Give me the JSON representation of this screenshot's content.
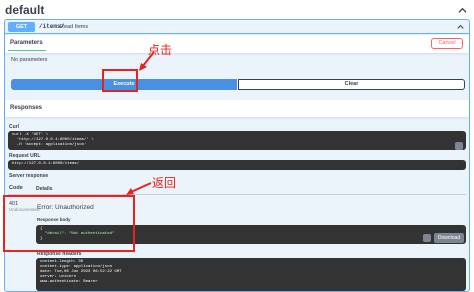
{
  "section": {
    "title": "default"
  },
  "operation": {
    "method": "GET",
    "path": "/items/",
    "description": "Read Items"
  },
  "tabs": {
    "parameters_label": "Parameters",
    "cancel_label": "Cancel"
  },
  "params": {
    "empty_text": "No parameters"
  },
  "actions": {
    "execute_label": "Execute",
    "clear_label": "Clear"
  },
  "responses": {
    "title": "Responses",
    "curl_label": "Curl",
    "curl_lines": [
      "curl -X 'GET' \\",
      "  'http://127.0.0.1:8000/items/' \\",
      "  -H 'accept: application/json'"
    ],
    "request_url_label": "Request URL",
    "request_url": "http://127.0.0.1:8000/items/",
    "server_response_label": "Server response",
    "col_code": "Code",
    "col_details": "Details",
    "status_code": "401",
    "undocumented": "Undocumented",
    "error_text": "Error: Unauthorized",
    "body_label": "Response body",
    "body_lines": [
      "{",
      "  \"detail\": \"Not authenticated\"",
      "}"
    ],
    "download_label": "Download",
    "headers_label": "Response headers",
    "header_lines": [
      "content-length: 30",
      "content-type: application/json",
      "date: Tue,06 Jun 2023 06:52:22 GMT",
      "server: uvicorn",
      "www-authenticate: Bearer"
    ]
  },
  "annotations": {
    "click_label": "点击",
    "return_label": "返回"
  },
  "colors": {
    "get": "#61affe",
    "execute": "#4990e2",
    "annotation": "#e8231f",
    "cancel": "#ff6060"
  }
}
